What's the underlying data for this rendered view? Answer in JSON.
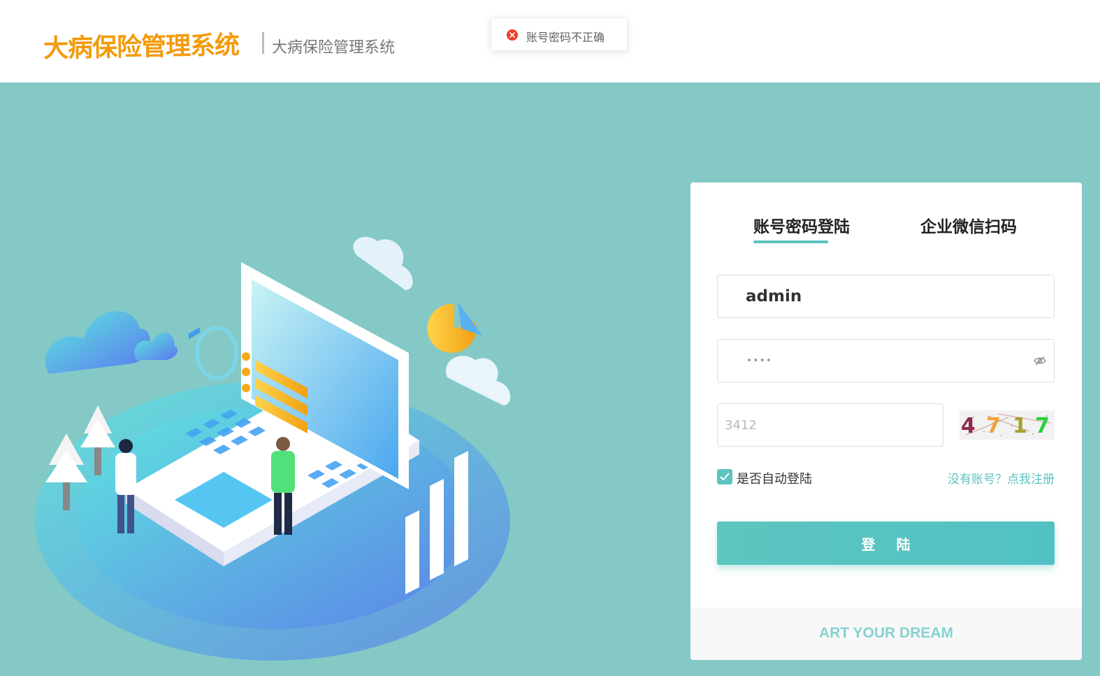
{
  "header": {
    "logo_text": "大病保险管理系统",
    "subtitle": "大病保险管理系统"
  },
  "toast": {
    "icon": "error-circle-icon",
    "message": "账号密码不正确"
  },
  "login": {
    "tabs": [
      {
        "label": "账号密码登陆",
        "active": true
      },
      {
        "label": "企业微信扫码",
        "active": false
      }
    ],
    "username_value": "admin",
    "password_mask": "••••",
    "captcha_placeholder": "3412",
    "captcha_code": [
      "4",
      "7",
      "1",
      "7"
    ],
    "remember_label": "是否自动登陆",
    "remember_checked": true,
    "register_link": "没有账号？点我注册",
    "submit_label": "登陆",
    "footer_text": "ART YOUR DREAM"
  },
  "colors": {
    "background": "#84c9c5",
    "accent": "#5cc3bf",
    "logo": "#f39a0b",
    "error": "#ee3d2c"
  }
}
